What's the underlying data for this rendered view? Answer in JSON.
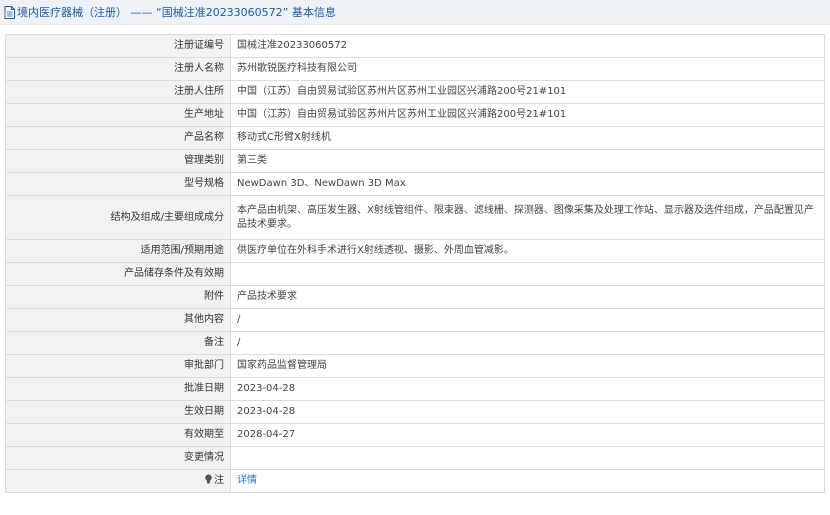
{
  "header": {
    "title": "境内医疗器械（注册） —— “国械注准20233060572” 基本信息",
    "icon": "document-icon"
  },
  "colors": {
    "title_text": "#1a5ea6",
    "label_bg": "#f2f2f2",
    "link": "#2a6fc9"
  },
  "rows": [
    {
      "label": "注册证编号",
      "value": "国械注准20233060572"
    },
    {
      "label": "注册人名称",
      "value": "苏州歌锐医疗科技有限公司"
    },
    {
      "label": "注册人住所",
      "value": "中国（江苏）自由贸易试验区苏州片区苏州工业园区兴浦路200号21#101"
    },
    {
      "label": "生产地址",
      "value": "中国（江苏）自由贸易试验区苏州片区苏州工业园区兴浦路200号21#101"
    },
    {
      "label": "产品名称",
      "value": "移动式C形臂X射线机"
    },
    {
      "label": "管理类别",
      "value": "第三类"
    },
    {
      "label": "型号规格",
      "value": "NewDawn 3D、NewDawn 3D Max"
    },
    {
      "label": "结构及组成/主要组成成分",
      "value": "本产品由机架、高压发生器、X射线管组件、限束器、滤线栅、探测器、图像采集及处理工作站、显示器及选件组成，产品配置见产品技术要求。"
    },
    {
      "label": "适用范围/预期用途",
      "value": "供医疗单位在外科手术进行X射线透视、摄影、外周血管减影。"
    },
    {
      "label": "产品储存条件及有效期",
      "value": ""
    },
    {
      "label": "附件",
      "value": "产品技术要求"
    },
    {
      "label": "其他内容",
      "value": "/"
    },
    {
      "label": "备注",
      "value": "/"
    },
    {
      "label": "审批部门",
      "value": "国家药品监督管理局"
    },
    {
      "label": "批准日期",
      "value": "2023-04-28"
    },
    {
      "label": "生效日期",
      "value": "2023-04-28"
    },
    {
      "label": "有效期至",
      "value": "2028-04-27"
    },
    {
      "label": "变更情况",
      "value": ""
    }
  ],
  "note_row": {
    "label": "注",
    "icon": "lightbulb-icon",
    "link_text": "详情"
  }
}
